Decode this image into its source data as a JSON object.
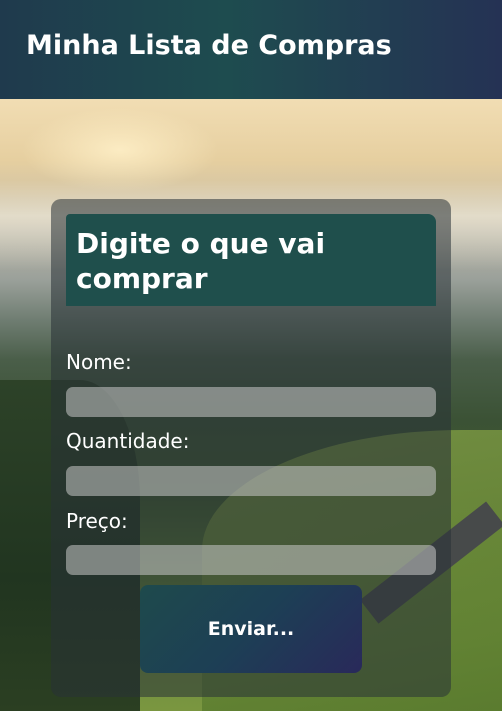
{
  "header": {
    "title": "Minha Lista de Compras"
  },
  "form": {
    "heading": "Digite o que vai comprar",
    "fields": [
      {
        "label": "Nome:",
        "value": "",
        "placeholder": ""
      },
      {
        "label": "Quantidade:",
        "value": "",
        "placeholder": ""
      },
      {
        "label": "Preço:",
        "value": "",
        "placeholder": ""
      }
    ],
    "submit_label": "Enviar..."
  },
  "colors": {
    "header_gradient_start": "#1f3a4d",
    "header_gradient_end": "#253254",
    "heading_background": "#1f4f4c",
    "button_gradient_start": "#1e4a4c",
    "button_gradient_end": "#29295a"
  }
}
